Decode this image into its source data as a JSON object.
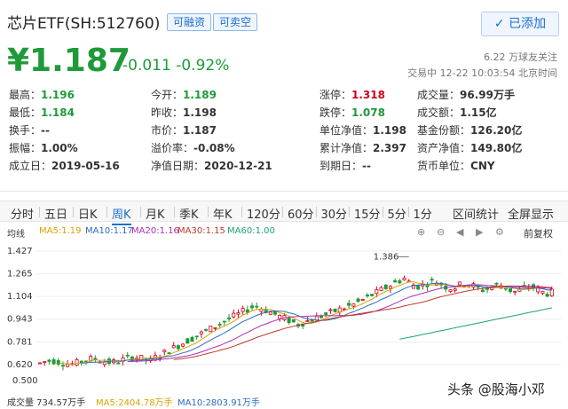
{
  "header": {
    "title": "芯片ETF(SH:512760)",
    "tags": [
      "可融资",
      "可卖空"
    ],
    "add_button": "已添加",
    "price": "¥1.187",
    "change": "-0.011",
    "change_pct": "-0.92%",
    "follow": "6.22 万球友关注",
    "trade_status": "交易中 12-22 10:03:54 北京时间"
  },
  "quote": {
    "rows": [
      [
        {
          "label": "最高：",
          "value": "1.196",
          "color": "green"
        },
        {
          "label": "今开：",
          "value": "1.189",
          "color": "green"
        },
        {
          "label": "涨停：",
          "value": "1.318",
          "color": "red"
        },
        {
          "label": "成交量：",
          "value": "96.99万手",
          "color": ""
        }
      ],
      [
        {
          "label": "最低：",
          "value": "1.184",
          "color": "green"
        },
        {
          "label": "昨收：",
          "value": "1.198",
          "color": ""
        },
        {
          "label": "跌停：",
          "value": "1.078",
          "color": "green"
        },
        {
          "label": "成交额：",
          "value": "1.15亿",
          "color": ""
        }
      ],
      [
        {
          "label": "换手：",
          "value": "--",
          "color": ""
        },
        {
          "label": "市价：",
          "value": "1.187",
          "color": ""
        },
        {
          "label": "单位净值：",
          "value": "1.198",
          "color": ""
        },
        {
          "label": "基金份额：",
          "value": "126.20亿",
          "color": ""
        }
      ],
      [
        {
          "label": "振幅：",
          "value": "1.00%",
          "color": ""
        },
        {
          "label": "溢价率：",
          "value": "-0.08%",
          "color": ""
        },
        {
          "label": "累计净值：",
          "value": "2.397",
          "color": ""
        },
        {
          "label": "资产净值：",
          "value": "149.80亿",
          "color": ""
        }
      ],
      [
        {
          "label": "成立日：",
          "value": "2019-05-16",
          "color": ""
        },
        {
          "label": "净值日期：",
          "value": "2020-12-21",
          "color": ""
        },
        {
          "label": "到期日：",
          "value": "--",
          "color": ""
        },
        {
          "label": "货币单位：",
          "value": "CNY",
          "color": ""
        }
      ]
    ]
  },
  "tabs": [
    "分时",
    "五日",
    "日K",
    "周K",
    "月K",
    "季K",
    "年K",
    "120分",
    "60分",
    "30分",
    "15分",
    "5分",
    "1分"
  ],
  "active_tab": "周K",
  "tools": [
    "区间统计",
    "全屏显示"
  ],
  "ma_bar": {
    "mode": "均线",
    "items": [
      {
        "text": "MA5:1.19",
        "color": "#d9a400"
      },
      {
        "text": "MA10:1.17",
        "color": "#2b6cc4"
      },
      {
        "text": "MA20:1.16",
        "color": "#b02fb0"
      },
      {
        "text": "MA30:1.15",
        "color": "#c0392b"
      },
      {
        "text": "MA60:1.00",
        "color": "#1aa37a"
      }
    ],
    "fuquan": "前复权"
  },
  "chart_data": {
    "type": "candlestick",
    "y_ticks": [
      1.427,
      1.265,
      1.104,
      0.943,
      0.781,
      0.62
    ],
    "low_label": "0.500",
    "high_annotation": "1.386",
    "ylim": [
      0.45,
      1.47
    ]
  },
  "volume_bar": {
    "label": "成交量 734.57万手",
    "ma5": "MA5:2404.78万手",
    "ma10": "MA10:2803.91万手"
  },
  "watermark": "头条 @股海小邓"
}
